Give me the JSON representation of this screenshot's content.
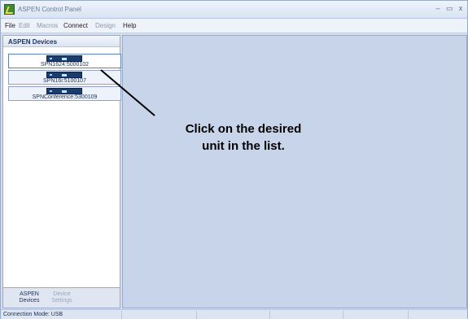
{
  "window": {
    "title": "ASPEN Control Panel",
    "controls": [
      "–",
      "▭",
      "x"
    ]
  },
  "menu": {
    "file": "File",
    "edit": "Edit",
    "macros": "Macros",
    "connect": "Connect",
    "design": "Design",
    "help": "Help"
  },
  "sidebar": {
    "header": "ASPEN Devices",
    "devices": [
      {
        "label": "SPN1624:5000102"
      },
      {
        "label": "SPN16i:5100107"
      },
      {
        "label": "SPNConference:5300109"
      }
    ],
    "tabs": [
      {
        "line1": "ASPEN",
        "line2": "Devices"
      },
      {
        "line1": "Device",
        "line2": "Settings"
      }
    ]
  },
  "annotation": {
    "line1": "Click on the desired",
    "line2": "unit in the list."
  },
  "status": {
    "text": "Connection Mode: USB"
  }
}
